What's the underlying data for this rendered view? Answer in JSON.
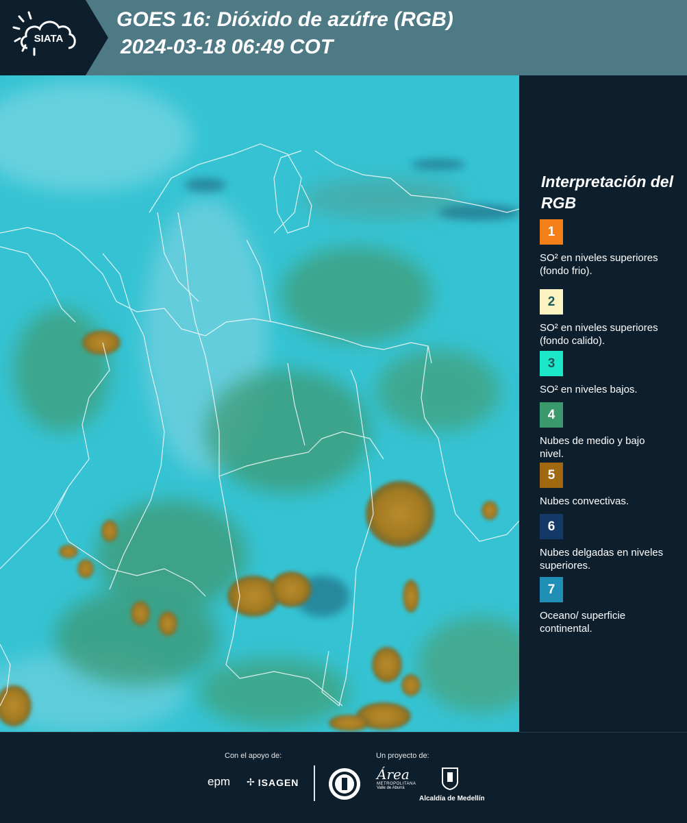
{
  "header": {
    "logo_text": "SIATA",
    "title_line1": "GOES 16: Dióxido de azúfre (RGB)",
    "title_line2": "2024-03-18 06:49 COT"
  },
  "legend": {
    "title": "Interpretación del RGB",
    "items": [
      {
        "number": "1",
        "label": "SO² en niveles superiores (fondo frio).",
        "color": "#f47f16"
      },
      {
        "number": "2",
        "label": "SO² en niveles superiores (fondo calido).",
        "color": "#fdf3c2"
      },
      {
        "number": "3",
        "label": "SO² en niveles bajos.",
        "color": "#1ae8c8"
      },
      {
        "number": "4",
        "label": "Nubes de medio y bajo nivel.",
        "color": "#3a9a6e"
      },
      {
        "number": "5",
        "label": "Nubes convectivas.",
        "color": "#a0690f"
      },
      {
        "number": "6",
        "label": "Nubes delgadas en niveles superiores.",
        "color": "#143868"
      },
      {
        "number": "7",
        "label": "Oceano/ superficie continental.",
        "color": "#1f8fb5"
      }
    ]
  },
  "footer": {
    "support_label": "Con el apoyo de:",
    "project_label": "Un proyecto de:",
    "epm": "epm",
    "isagen": "ISAGEN",
    "area_script": "Área",
    "area_name": "METROPOLITANA",
    "area_sub": "Valle de Aburrá",
    "alcaldia": "Alcaldía de Medellín"
  },
  "colors": {
    "header_bg": "#4e7a86",
    "panel_bg": "#0d1f2d",
    "map_cyan": "#35c3d3",
    "map_green": "#3f9c74",
    "map_convective": "#b58a28"
  }
}
